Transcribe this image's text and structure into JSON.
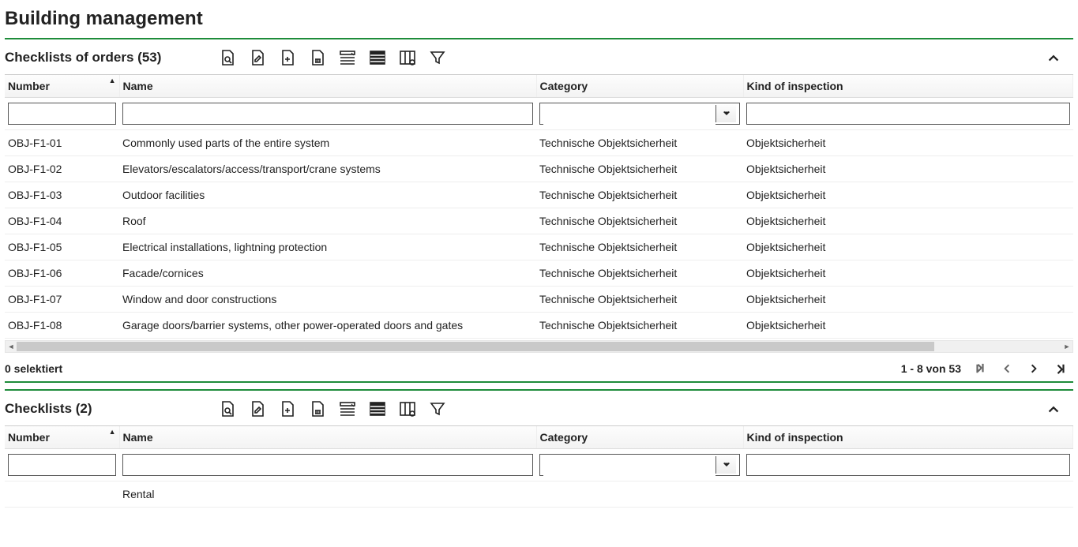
{
  "page_title": "Building management",
  "sections": [
    {
      "id": "orders",
      "title": "Checklists of orders (53)",
      "columns": [
        "Number",
        "Name",
        "Category",
        "Kind of inspection"
      ],
      "sorted_col_index": 0,
      "rows": [
        {
          "number": "OBJ-F1-01",
          "name": "Commonly used parts of the entire system",
          "category": "Technische Objektsicherheit",
          "kind": "Objektsicherheit"
        },
        {
          "number": "OBJ-F1-02",
          "name": "Elevators/escalators/access/transport/crane systems",
          "category": "Technische Objektsicherheit",
          "kind": "Objektsicherheit"
        },
        {
          "number": "OBJ-F1-03",
          "name": "Outdoor facilities",
          "category": "Technische Objektsicherheit",
          "kind": "Objektsicherheit"
        },
        {
          "number": "OBJ-F1-04",
          "name": "Roof",
          "category": "Technische Objektsicherheit",
          "kind": "Objektsicherheit"
        },
        {
          "number": "OBJ-F1-05",
          "name": "Electrical installations, lightning protection",
          "category": "Technische Objektsicherheit",
          "kind": "Objektsicherheit"
        },
        {
          "number": "OBJ-F1-06",
          "name": "Facade/cornices",
          "category": "Technische Objektsicherheit",
          "kind": "Objektsicherheit"
        },
        {
          "number": "OBJ-F1-07",
          "name": "Window and door constructions",
          "category": "Technische Objektsicherheit",
          "kind": "Objektsicherheit"
        },
        {
          "number": "OBJ-F1-08",
          "name": "Garage doors/barrier systems, other power-operated doors and gates",
          "category": "Technische Objektsicherheit",
          "kind": "Objektsicherheit"
        }
      ],
      "footer": {
        "selection_text": "0 selektiert",
        "range_text": "1 - 8 von 53"
      }
    },
    {
      "id": "checklists",
      "title": "Checklists (2)",
      "columns": [
        "Number",
        "Name",
        "Category",
        "Kind of inspection"
      ],
      "sorted_col_index": 0,
      "rows": [
        {
          "number": "",
          "name": "Rental",
          "category": "",
          "kind": ""
        }
      ]
    }
  ],
  "toolbar_icons": [
    "doc-view-icon",
    "doc-edit-icon",
    "doc-add-icon",
    "doc-delete-icon",
    "filter-row-icon",
    "list-icon",
    "columns-icon",
    "funnel-icon"
  ]
}
